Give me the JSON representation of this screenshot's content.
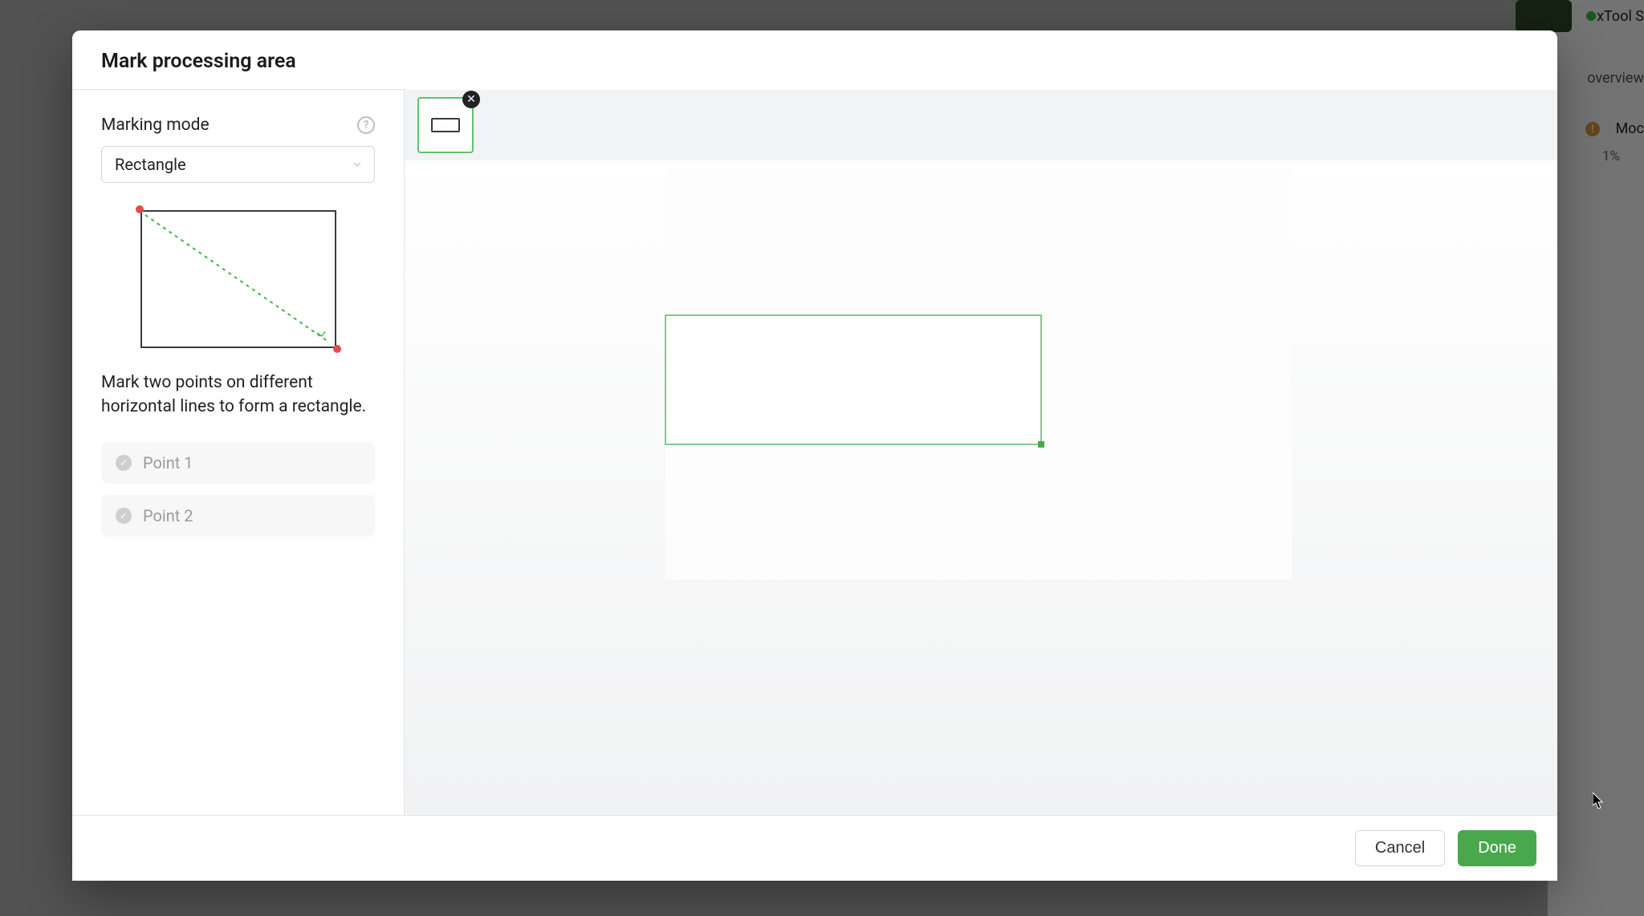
{
  "modal": {
    "title": "Mark processing area",
    "sidebar": {
      "marking_mode_label": "Marking mode",
      "mode_select_value": "Rectangle",
      "instruction": "Mark two points on different horizontal lines to form a rectangle.",
      "points": [
        {
          "label": "Point 1"
        },
        {
          "label": "Point 2"
        }
      ]
    },
    "footer": {
      "cancel": "Cancel",
      "done": "Done"
    }
  },
  "bg": {
    "app_name": "xTool S",
    "overview": "overview",
    "moc": "Moc",
    "pct": "1%"
  },
  "colors": {
    "accent": "#49A84C",
    "danger": "#E24B4B",
    "warn": "#E59A39"
  }
}
